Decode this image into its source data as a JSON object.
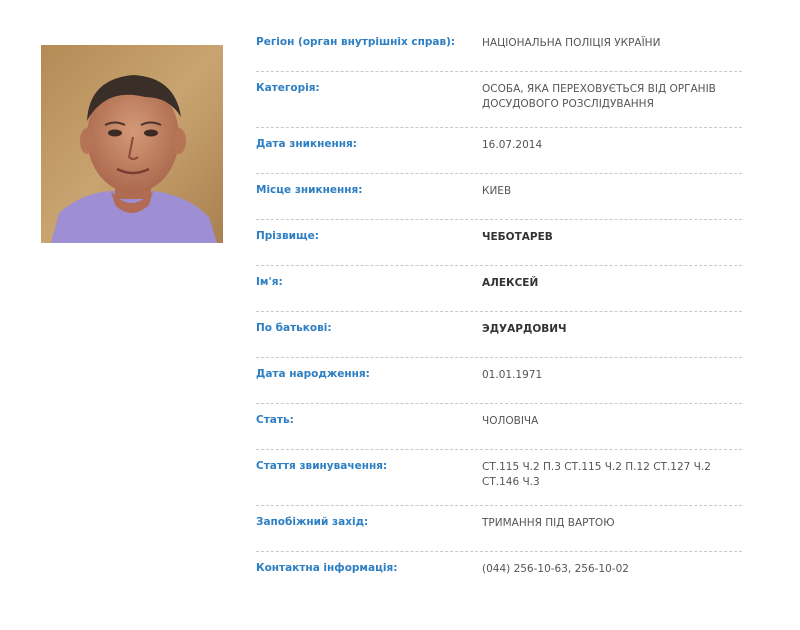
{
  "photo": {
    "icon": "person-photo"
  },
  "fields": [
    {
      "key": "region",
      "label": "Регіон (орган внутрішніх справ):",
      "value": "НАЦІОНАЛЬНА ПОЛІЦІЯ УКРАЇНИ",
      "strong": false
    },
    {
      "key": "category",
      "label": "Категорія:",
      "value": "ОСОБА, ЯКА ПЕРЕХОВУЄТЬСЯ ВІД ОРГАНІВ ДОСУДОВОГО РОЗСЛІДУВАННЯ",
      "strong": false
    },
    {
      "key": "disappearance-date",
      "label": "Дата зникнення:",
      "value": "16.07.2014",
      "strong": false
    },
    {
      "key": "disappearance-place",
      "label": "Місце зникнення:",
      "value": "КИЕВ",
      "strong": false
    },
    {
      "key": "surname",
      "label": "Прізвище:",
      "value": "ЧЕБОТАРЕВ",
      "strong": true
    },
    {
      "key": "first-name",
      "label": "Ім'я:",
      "value": "АЛЕКСЕЙ",
      "strong": true
    },
    {
      "key": "patronymic",
      "label": "По батькові:",
      "value": "ЭДУАРДОВИЧ",
      "strong": true
    },
    {
      "key": "birth-date",
      "label": "Дата народження:",
      "value": "01.01.1971",
      "strong": false
    },
    {
      "key": "sex",
      "label": "Стать:",
      "value": "ЧОЛОВІЧА",
      "strong": false
    },
    {
      "key": "charges",
      "label": "Стаття звинувачення:",
      "value": "СТ.115 Ч.2 П.3 СТ.115 Ч.2 П.12 СТ.127 Ч.2 СТ.146 Ч.3",
      "strong": false
    },
    {
      "key": "preventive-measure",
      "label": "Запобіжний захід:",
      "value": "ТРИМАННЯ ПІД ВАРТОЮ",
      "strong": false
    },
    {
      "key": "contact-info",
      "label": "Контактна інформація:",
      "value": "(044) 256-10-63, 256-10-02",
      "strong": false
    }
  ]
}
